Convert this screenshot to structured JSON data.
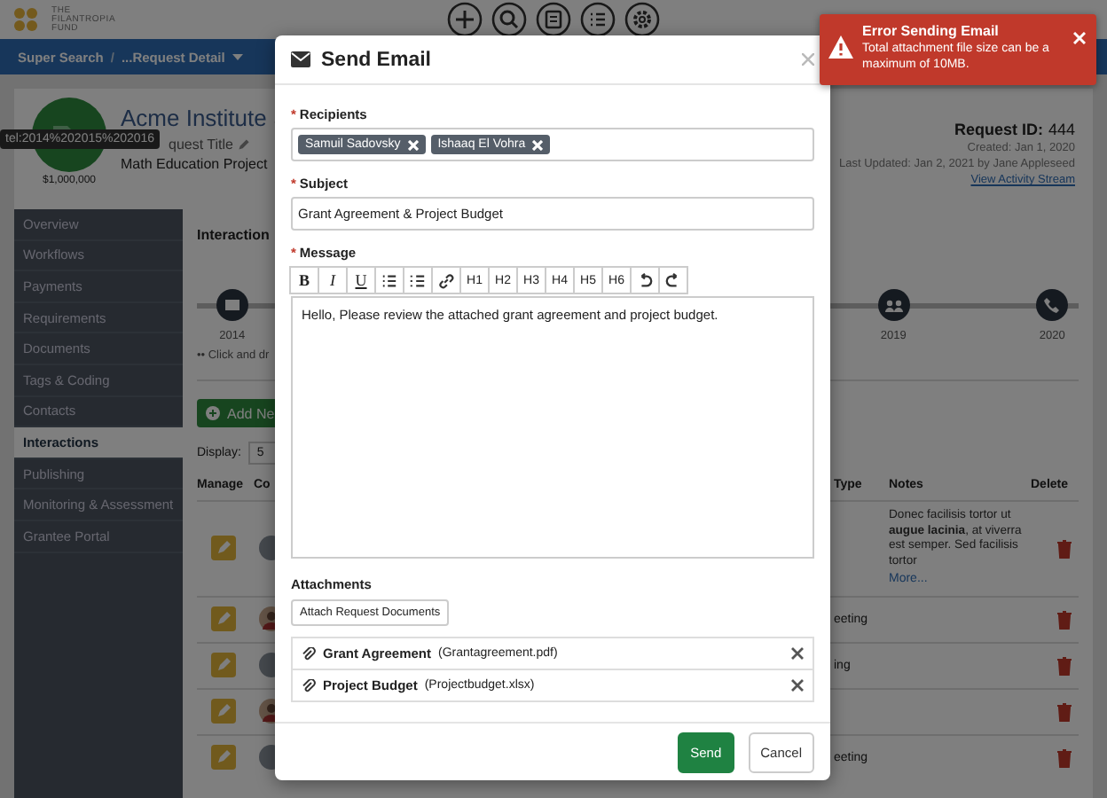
{
  "header": {
    "logo": [
      "THE",
      "FILANTROPIA",
      "FUND"
    ]
  },
  "breadcrumb": [
    {
      "label": "Super Search"
    },
    {
      "label": "...Request Detail"
    }
  ],
  "breadcrumb_separator": "/",
  "organization": {
    "name": "Acme Institute",
    "amount": "$1,000,000",
    "title_label": "quest Title",
    "title": "Math Education Project"
  },
  "tooltip": "tel:2014%202015%202016",
  "request": {
    "id_label": "Request ID:",
    "id": "444",
    "created": "Created: Jan 1, 2020",
    "updated": "Last Updated: Jan 2, 2021 by Jane Appleseed",
    "link": "View Activity Stream"
  },
  "sidebar": {
    "items": [
      {
        "label": "Overview",
        "selected": false
      },
      {
        "label": "Workflows",
        "selected": false
      },
      {
        "label": "Payments",
        "selected": false
      },
      {
        "label": "Requirements",
        "selected": false
      },
      {
        "label": "Documents",
        "selected": false
      },
      {
        "label": "Tags & Coding",
        "selected": false
      },
      {
        "label": "Contacts",
        "selected": false
      },
      {
        "label": "Interactions",
        "selected": true
      },
      {
        "label": "Publishing",
        "selected": false
      },
      {
        "label": "Monitoring & Assessment",
        "selected": false
      },
      {
        "label": "Grantee Portal",
        "selected": false
      }
    ]
  },
  "interactions": {
    "title": "Interaction",
    "timeline": [
      {
        "kind": "meeting",
        "year": "2014"
      },
      {
        "kind": "people",
        "year": "2019"
      },
      {
        "kind": "phone",
        "year": "2020"
      }
    ],
    "hint": "•• Click and dr",
    "add_button": "Add Ne",
    "display_label": "Display:",
    "display_value": "5",
    "columns": [
      "Manage",
      "Co",
      "Type",
      "Notes",
      "Delete"
    ],
    "rows": [
      {
        "notes": "Donec facilisis tortor ut **augue lacinia**, at viverra est semper. Sed facilisis tortor",
        "more": "More..."
      },
      {
        "type": "eeting"
      },
      {
        "type": "ing"
      },
      {},
      {
        "type": "eeting"
      }
    ]
  },
  "email_dialog": {
    "title": "Send Email",
    "recipients": {
      "mark": "*",
      "label": "Recipients",
      "tags": [
        "Samuil Sadovsky",
        "Ishaaq El Vohra"
      ]
    },
    "subject": {
      "mark": "*",
      "label": "Subject",
      "value": "Grant Agreement & Project Budget"
    },
    "message": {
      "mark": "*",
      "label": "Message",
      "toolbar": [
        {
          "kind": "bold",
          "label": "B"
        },
        {
          "kind": "italic",
          "label": "I"
        },
        {
          "kind": "underline",
          "label": "U"
        },
        {
          "kind": "bullet-list"
        },
        {
          "kind": "numbered-list"
        },
        {
          "kind": "link"
        },
        {
          "kind": "heading",
          "label": "H1"
        },
        {
          "kind": "heading",
          "label": "H2"
        },
        {
          "kind": "heading",
          "label": "H3"
        },
        {
          "kind": "heading",
          "label": "H4"
        },
        {
          "kind": "heading",
          "label": "H5"
        },
        {
          "kind": "heading",
          "label": "H6"
        },
        {
          "kind": "undo"
        },
        {
          "kind": "redo"
        }
      ],
      "value": "Hello, Please review the attached grant agreement and project budget."
    },
    "attachments": {
      "label": "Attachments",
      "button": "Attach Request Documents",
      "files": [
        {
          "name": "Grant Agreement",
          "file": "(Grantagreement.pdf)"
        },
        {
          "name": "Project Budget",
          "file": "(Projectbudget.xlsx)"
        }
      ]
    },
    "buttons": [
      {
        "kind": "primary",
        "label": "Send"
      },
      {
        "kind": "default",
        "label": "Cancel"
      }
    ]
  },
  "toast": {
    "title": "Error Sending Email",
    "message": "Total attachment file size can be a maximum of 10MB."
  }
}
